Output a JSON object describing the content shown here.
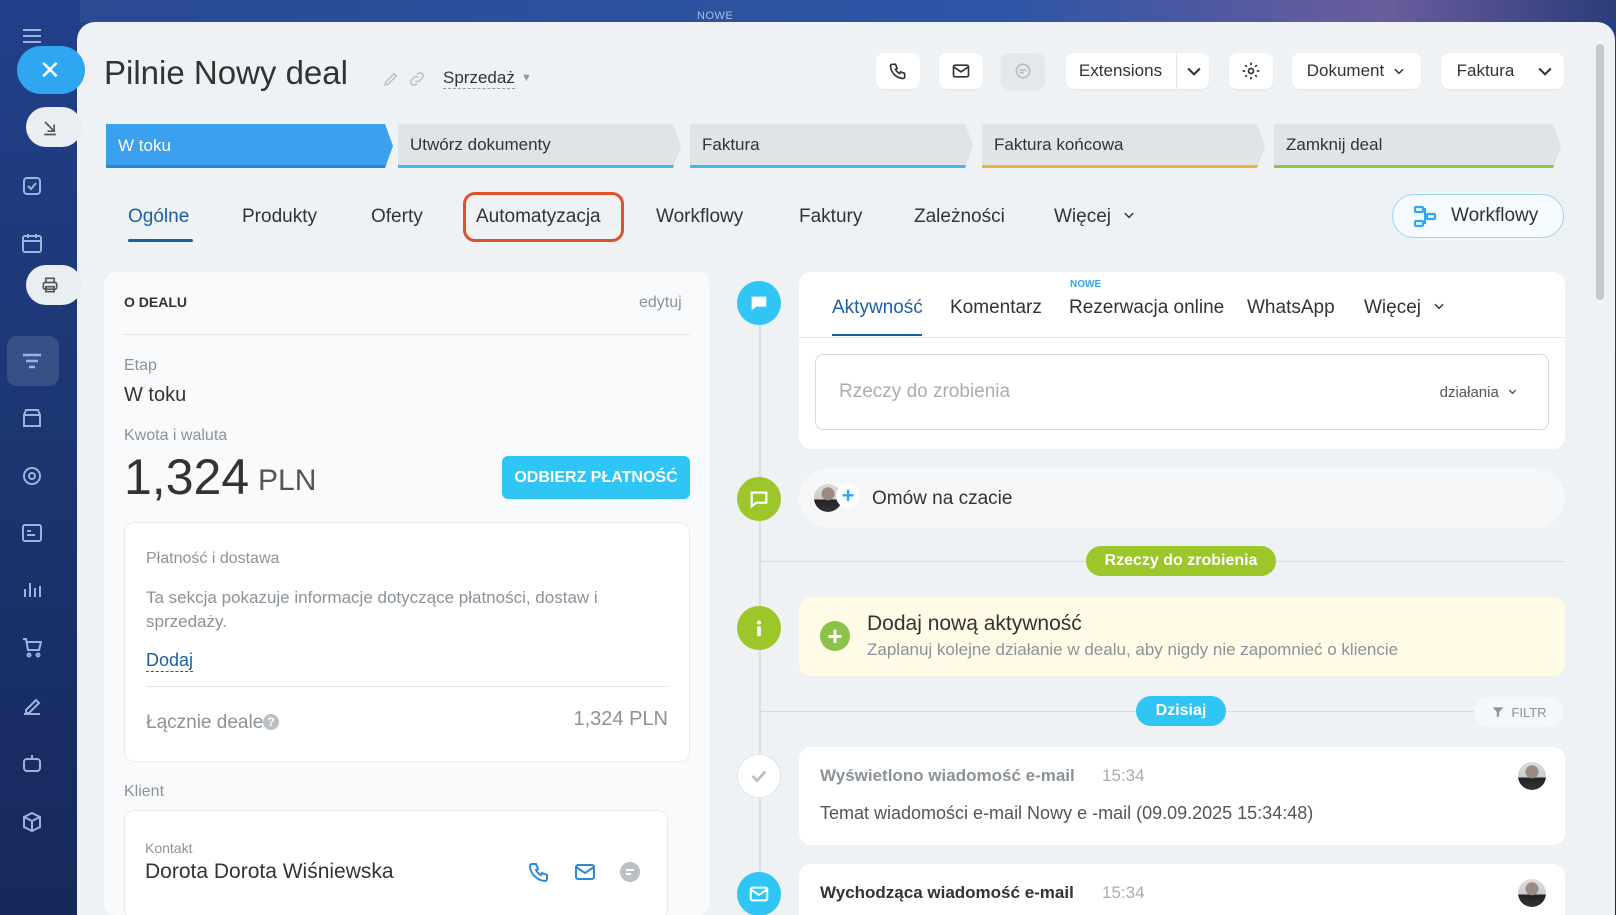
{
  "top_badge": "NOWE",
  "deal": {
    "title": "Pilnie Nowy deal",
    "category": "Sprzedaż"
  },
  "toolbar": {
    "extensions": "Extensions",
    "dokument": "Dokument",
    "faktura": "Faktura"
  },
  "stages": [
    {
      "label": "W toku",
      "color": "#3ba0ee"
    },
    {
      "label": "Utwórz dokumenty",
      "color": "#47b7e8"
    },
    {
      "label": "Faktura",
      "color": "#47b7e8"
    },
    {
      "label": "Faktura końcowa",
      "color": "#f0b03a"
    },
    {
      "label": "Zamknij deal",
      "color": "#8bc93f"
    }
  ],
  "tabs": [
    "Ogólne",
    "Produkty",
    "Oferty",
    "Automatyzacja",
    "Workflowy",
    "Faktury",
    "Zależności",
    "Więcej"
  ],
  "workflow_button": "Workflowy",
  "about": {
    "header": "O DEALU",
    "edit": "edytuj",
    "stage_label": "Etap",
    "stage_value": "W toku",
    "amount_label": "Kwota i waluta",
    "amount": "1,324",
    "currency": "PLN",
    "pay_button": "ODBIERZ PŁATNOŚĆ",
    "payment": {
      "title": "Płatność i dostawa",
      "description": "Ta sekcja pokazuje informacje dotyczące płatności, dostaw i sprzedaży.",
      "add": "Dodaj",
      "total_label": "Łącznie deale",
      "total_value": "1,324 PLN"
    },
    "client_label": "Klient",
    "contact_label": "Kontakt",
    "contact_name": "Dorota Dorota Wiśniewska"
  },
  "activity": {
    "tabs": [
      "Aktywność",
      "Komentarz",
      "Rezerwacja online",
      "WhatsApp",
      "Więcej"
    ],
    "new_badge": "NOWE",
    "todo_placeholder": "Rzeczy do zrobienia",
    "actions": "działania",
    "chat": "Omów na czacie",
    "todo_pill": "Rzeczy do zrobienia",
    "add_title": "Dodaj nową aktywność",
    "add_sub": "Zaplanuj kolejne działanie w dealu, aby nigdy nie zapomnieć o kliencie",
    "today_pill": "Dzisiaj",
    "filter": "FILTR",
    "item1_title": "Wyświetlono wiadomość e-mail",
    "item1_time": "15:34",
    "item1_body": "Temat wiadomości e-mail Nowy e -mail (09.09.2025 15:34:48)",
    "item2_title": "Wychodząca wiadomość e-mail",
    "item2_time": "15:34"
  },
  "colors": {
    "accent": "#3ba0ee",
    "link": "#1a5fa8",
    "green": "#8bc34a",
    "highlight": "#e0512b"
  }
}
